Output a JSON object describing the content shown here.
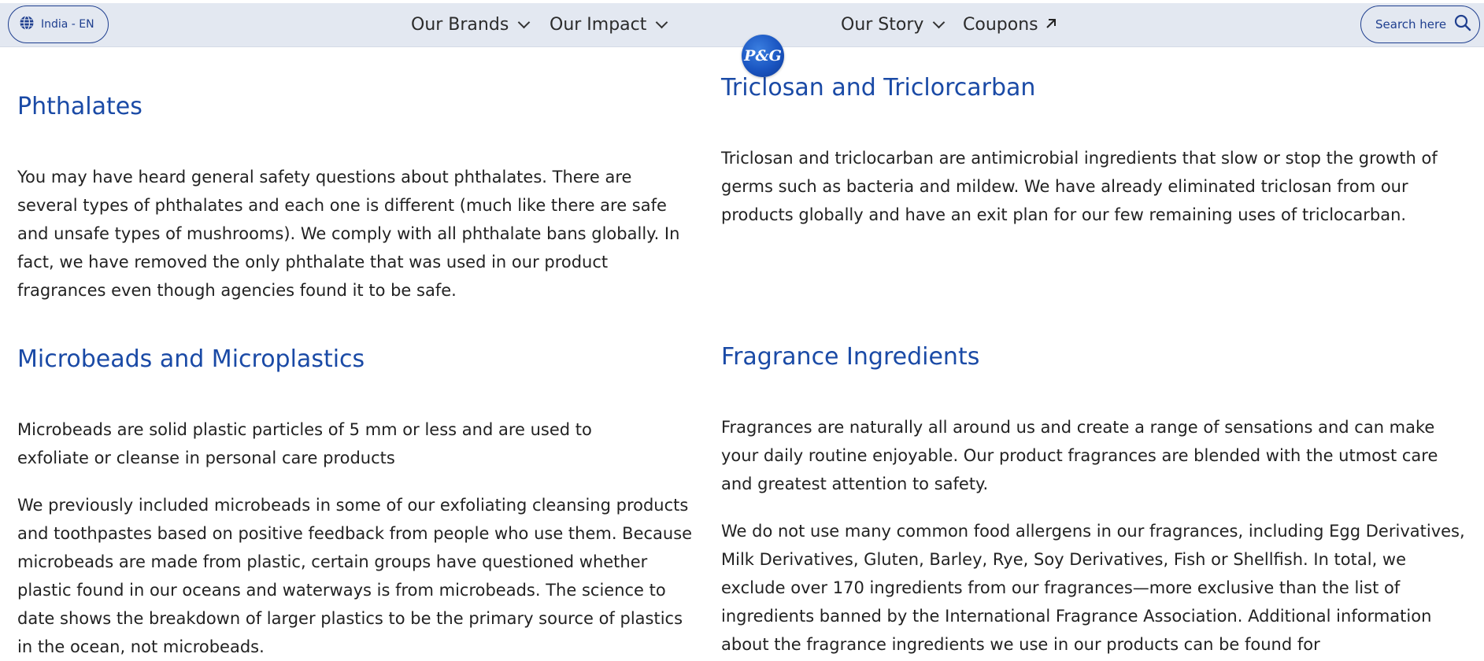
{
  "header": {
    "locale_label": "India - EN",
    "nav": {
      "brands": "Our Brands",
      "impact": "Our Impact",
      "story": "Our Story",
      "coupons": "Coupons"
    },
    "search_label": "Search here",
    "logo_text": "P&G"
  },
  "left": {
    "phthalates": {
      "title": "Phthalates",
      "body": "You may have heard general safety questions about phthalates. There are several types of phthalates and each one is different (much like there are safe and unsafe types of mushrooms). We comply with all phthalate bans globally. In fact, we have removed the only phthalate that was used in our product fragrances even though agencies found it to be safe."
    },
    "microbeads": {
      "title": "Microbeads and Microplastics",
      "body1": "Microbeads are solid plastic particles of 5 mm or less and are used to exfoliate or cleanse in personal care products",
      "body2": "We previously included microbeads in some of our exfoliating cleansing products and toothpastes based on positive feedback from people who use them. Because microbeads are made from plastic, certain groups have questioned whether plastic found in our oceans and waterways is from microbeads. The science to date shows the breakdown of larger plastics to be the primary source of plastics in the ocean, not microbeads."
    }
  },
  "right": {
    "triclosan": {
      "title": "Triclosan and Triclorcarban",
      "body": "Triclosan and triclocarban are antimicrobial ingredients that slow or stop the growth of germs such as bacteria and mildew. We have already eliminated triclosan from our products globally and have an exit plan for our few remaining uses of triclocarban."
    },
    "fragrance": {
      "title": "Fragrance Ingredients",
      "body1": "Fragrances are naturally all around us and create a range of sensations and can make your daily routine enjoyable. Our product fragrances are blended with the utmost care and greatest attention to safety.",
      "body2": "We do not use many common food allergens in our fragrances, including Egg Derivatives, Milk Derivatives, Gluten, Barley, Rye, Soy Derivatives, Fish or Shellfish. In total, we exclude over 170 ingredients from our fragrances—more exclusive than the list of ingredients banned by the International Fragrance Association. Additional information about the fragrance ingredients we use in our products can be found for"
    }
  },
  "colors": {
    "accent": "#1a4aa6",
    "nav_bg": "#e3e8f1",
    "button_border": "#1f3f8f"
  },
  "icons": [
    "globe-icon",
    "chevron-down-icon",
    "arrow-up-right-icon",
    "search-icon"
  ]
}
